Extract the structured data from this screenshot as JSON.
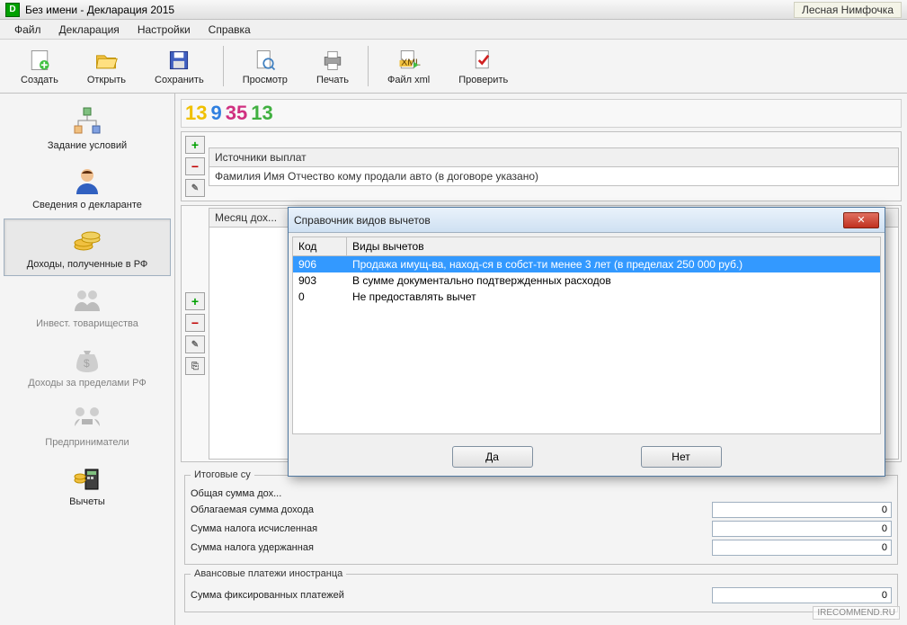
{
  "window": {
    "title": "Без имени - Декларация 2015",
    "user": "Лесная Нимфочка"
  },
  "menu": {
    "file": "Файл",
    "decl": "Декларация",
    "settings": "Настройки",
    "help": "Справка"
  },
  "toolbar": {
    "create": "Создать",
    "open": "Открыть",
    "save": "Сохранить",
    "preview": "Просмотр",
    "print": "Печать",
    "xml": "Файл xml",
    "check": "Проверить"
  },
  "years": {
    "a": "13",
    "b": "9",
    "c": "35",
    "d": "13"
  },
  "sidebar": {
    "items": [
      {
        "label": "Задание условий"
      },
      {
        "label": "Сведения о декларанте"
      },
      {
        "label": "Доходы, полученные в РФ"
      },
      {
        "label": "Инвест. товарищества"
      },
      {
        "label": "Доходы за пределами РФ"
      },
      {
        "label": "Предприниматели"
      },
      {
        "label": "Вычеты"
      }
    ]
  },
  "sources": {
    "header": "Источники выплат",
    "row": "Фамилия Имя Отчество кому продали авто (в договоре указано)"
  },
  "months": {
    "header": "Месяц дох..."
  },
  "summary": {
    "title": "Итоговые су",
    "total": "Общая сумма дох...",
    "taxable": "Облагаемая сумма дохода",
    "taxable_v": "0",
    "calc": "Сумма налога исчисленная",
    "calc_v": "0",
    "withheld": "Сумма налога удержанная",
    "withheld_v": "0",
    "advance_title": "Авансовые платежи иностранца",
    "fixed": "Сумма фиксированных платежей",
    "fixed_v": "0"
  },
  "dialog": {
    "title": "Справочник видов вычетов",
    "col_code": "Код",
    "col_desc": "Виды вычетов",
    "rows": [
      {
        "code": "906",
        "desc": "Продажа имущ-ва, наход-ся в собст-ти менее 3 лет (в пределах 250 000 руб.)"
      },
      {
        "code": "903",
        "desc": "В сумме документально подтвержденных расходов"
      },
      {
        "code": "0",
        "desc": "Не предоставлять вычет"
      }
    ],
    "yes": "Да",
    "no": "Нет"
  },
  "watermark": "IRECOMMEND.RU"
}
